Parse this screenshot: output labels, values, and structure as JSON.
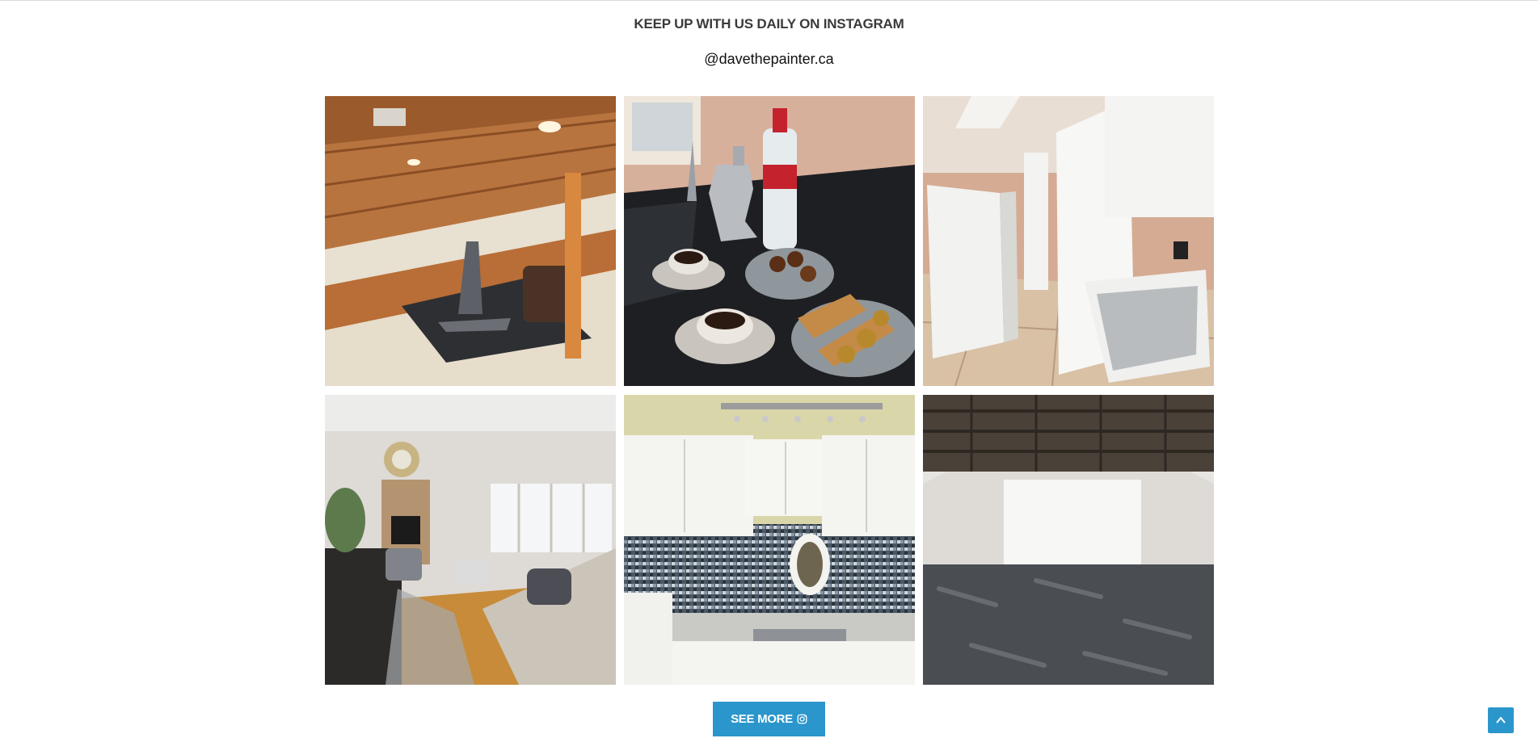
{
  "section": {
    "heading": "KEEP UP WITH US DAILY ON INSTAGRAM",
    "handle": "@davethepainter.ca"
  },
  "gallery": {
    "items": [
      {
        "subject": "basement gym with wood ceiling"
      },
      {
        "subject": "espresso pot, coffee cups and biscotti on granite counter"
      },
      {
        "subject": "kitchen cabinet installation in progress"
      },
      {
        "subject": "living room with fireplace and sunburst mirror"
      },
      {
        "subject": "white kitchen cabinets with mosaic backsplash"
      },
      {
        "subject": "empty room with painted floor and exposed ceiling"
      }
    ]
  },
  "cta": {
    "label": "SEE MORE",
    "icon": "instagram-icon"
  },
  "scroll_top": {
    "icon": "chevron-up-icon"
  },
  "colors": {
    "accent": "#2b96cb",
    "heading_text": "#3a3a3a"
  }
}
